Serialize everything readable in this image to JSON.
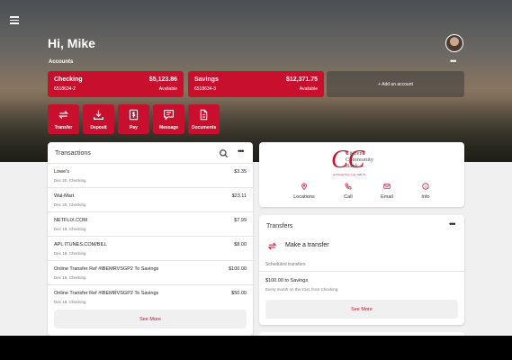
{
  "header": {
    "greeting": "Hi, Mike"
  },
  "accounts": {
    "label": "Accounts",
    "more": "•••",
    "items": [
      {
        "name": "Checking",
        "number": "6518634-2",
        "balance": "$5,123.86",
        "status": "Available"
      },
      {
        "name": "Savings",
        "number": "6518634-3",
        "balance": "$12,371.75",
        "status": "Available"
      }
    ],
    "add_label": "+ Add an account"
  },
  "quick_actions": [
    {
      "label": "Transfer",
      "icon": "transfer-icon"
    },
    {
      "label": "Deposit",
      "icon": "deposit-icon"
    },
    {
      "label": "Pay",
      "icon": "pay-icon"
    },
    {
      "label": "Message",
      "icon": "message-icon"
    },
    {
      "label": "Documents",
      "icon": "document-icon"
    }
  ],
  "transactions": {
    "title": "Transactions",
    "more": "•••",
    "items": [
      {
        "desc": "Lowe's",
        "date": "Dec 20, Checking",
        "amount": "$3.35"
      },
      {
        "desc": "Wal-Mart",
        "date": "Dec 20, Checking",
        "amount": "$23.11"
      },
      {
        "desc": "NETFLIX.COM",
        "date": "Dec 19, Checking",
        "amount": "$7.99"
      },
      {
        "desc": "APL ITUNES.COM/BILL",
        "date": "Dec 18, Checking",
        "amount": "$8.00"
      },
      {
        "desc": "Online Transfer Ref #IBEMRVSGP2 To Savings",
        "date": "Dec 18, Checking",
        "amount": "$100.00"
      },
      {
        "desc": "Online Transfer Ref #IBEMRVSGP2 To Savings",
        "date": "Dec 18, Checking",
        "amount": "$50.00"
      }
    ],
    "see_more": "See More"
  },
  "bank": {
    "logo_text": [
      "Citizens",
      "Community",
      "Bank"
    ],
    "tagline": "A Friend You Can Talk To",
    "actions": [
      {
        "label": "Locations",
        "icon": "location-pin-icon"
      },
      {
        "label": "Call",
        "icon": "phone-icon"
      },
      {
        "label": "Email",
        "icon": "mail-icon"
      },
      {
        "label": "Info",
        "icon": "info-icon"
      }
    ]
  },
  "transfers": {
    "title": "Transfers",
    "more": "•••",
    "make_label": "Make a transfer",
    "scheduled_label": "Scheduled transfers",
    "scheduled": [
      {
        "line1": "$100.00 to Savings",
        "line2": "Every month on the 21st, from Checking"
      }
    ],
    "see_more": "See More"
  },
  "colors": {
    "brand": "#c8102e",
    "background": "#f0f0f0"
  }
}
